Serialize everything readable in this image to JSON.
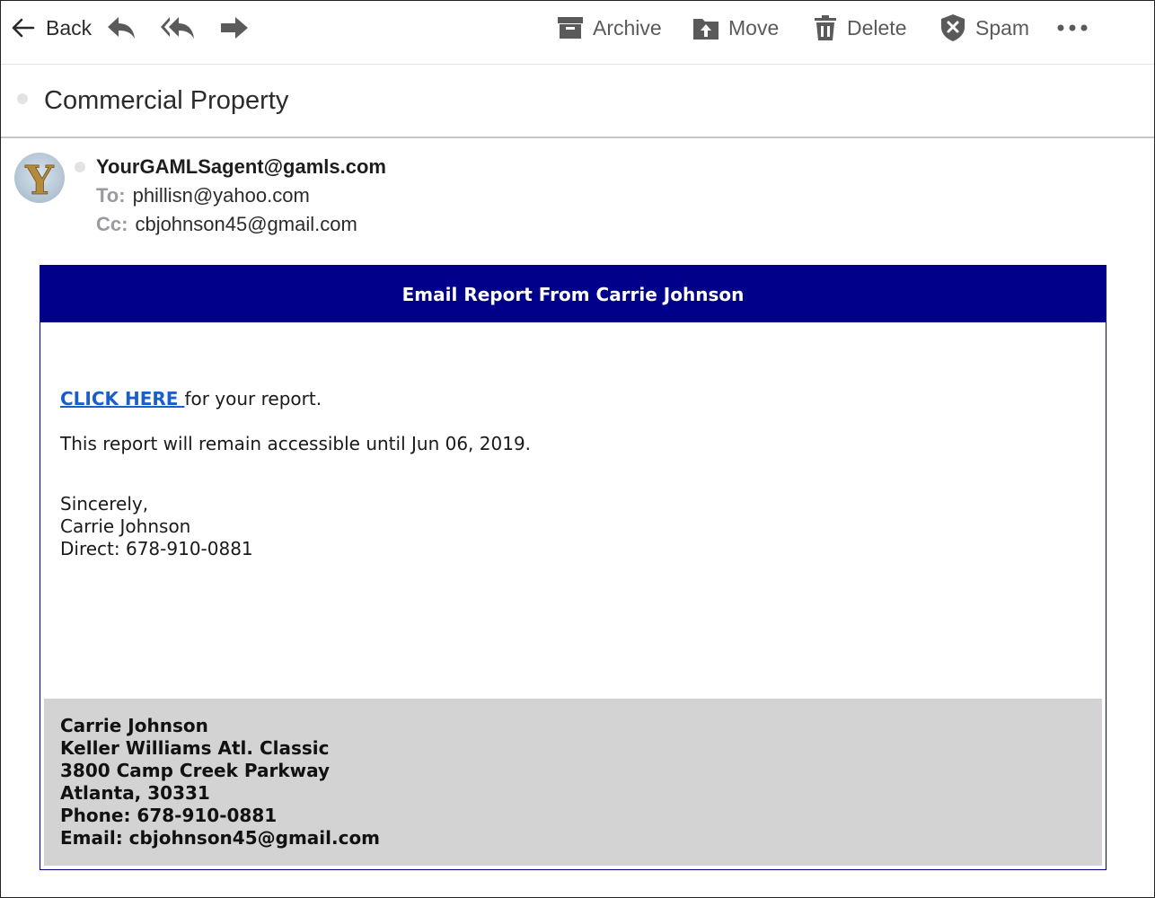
{
  "toolbar": {
    "back_label": "Back",
    "archive_label": "Archive",
    "move_label": "Move",
    "delete_label": "Delete",
    "spam_label": "Spam",
    "more_label": "•••",
    "icons": [
      "arrow-left-icon",
      "reply-icon",
      "reply-all-icon",
      "forward-icon",
      "archive-icon",
      "move-icon",
      "trash-icon",
      "shield-x-icon",
      "more-icon"
    ]
  },
  "subject": "Commercial Property",
  "header": {
    "avatar_letter": "Y",
    "from": "YourGAMLSagent@gamls.com",
    "to_label": "To:",
    "to": "phillisn@yahoo.com",
    "cc_label": "Cc:",
    "cc": "cbjohnson45@gmail.com"
  },
  "message": {
    "banner": "Email Report From Carrie Johnson",
    "link_text": "CLICK HERE ",
    "link_suffix": "for your report.",
    "accessible_text": "This report will remain accessible until Jun 06, 2019.",
    "closing": "Sincerely,",
    "sender_name": "Carrie Johnson",
    "direct": "Direct: 678-910-0881"
  },
  "footer": {
    "name": "Carrie Johnson",
    "company": "Keller Williams Atl. Classic",
    "address": "3800 Camp Creek Parkway",
    "city": "Atlanta, 30331",
    "phone": "Phone: 678-910-0881",
    "email": "Email: cbjohnson45@gmail.com"
  },
  "colors": {
    "banner": "#00008b",
    "link": "#1a5fc9",
    "footer_bg": "#d3d3d3",
    "toolbar_text": "#5a5a5a"
  }
}
